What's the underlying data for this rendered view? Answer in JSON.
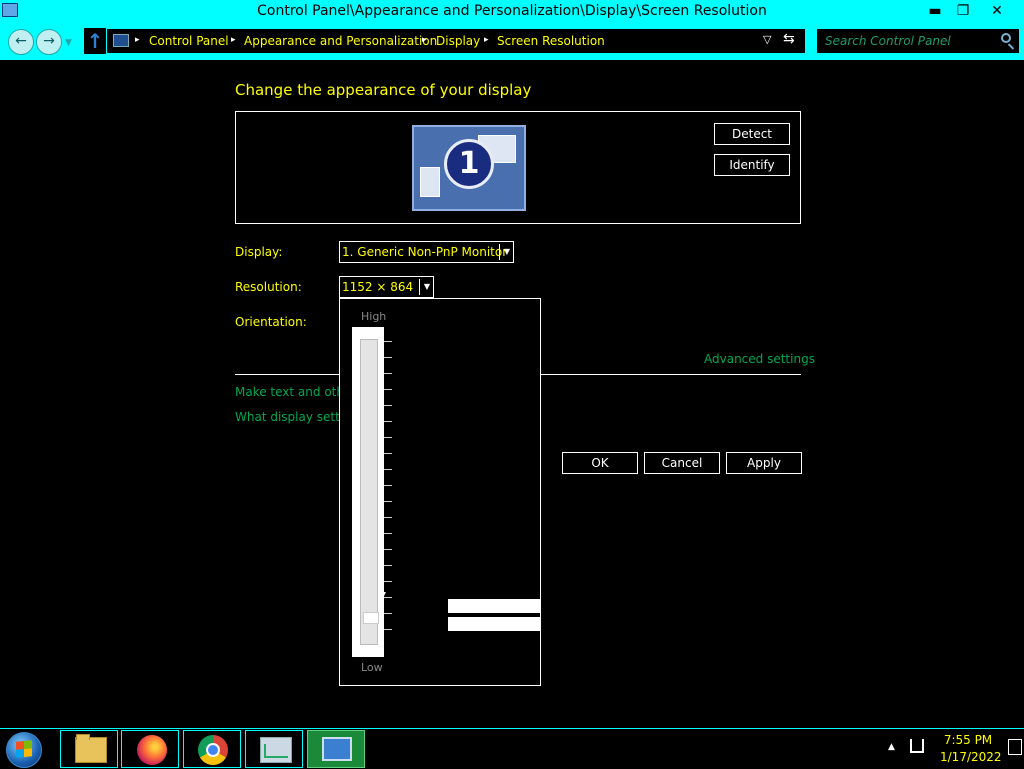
{
  "window": {
    "title": "Control Panel\\Appearance and Personalization\\Display\\Screen Resolution",
    "minimize_glyph": "▬",
    "restore_glyph": "❐",
    "close_glyph": "✕"
  },
  "navigation": {
    "back_glyph": "←",
    "forward_glyph": "→",
    "history_glyph": "▼",
    "up_glyph": "↑",
    "breadcrumbs": [
      "Control Panel",
      "Appearance and Personalization",
      "Display",
      "Screen Resolution"
    ],
    "separator": "▸",
    "dropdown_glyph": "▽",
    "refresh_glyph": "⇆",
    "search_placeholder": "Search Control Panel"
  },
  "content": {
    "heading": "Change the appearance of your display",
    "monitor_number": "1",
    "detect_label": "Detect",
    "identify_label": "Identify",
    "display_label": "Display:",
    "display_value": "1. Generic Non-PnP Monitor",
    "resolution_label": "Resolution:",
    "resolution_value": "1152 × 864",
    "orientation_label": "Orientation:",
    "advanced_settings_link": "Advanced settings",
    "text_size_link": "Make text and other",
    "display_help_link": "What display setting",
    "ok_label": "OK",
    "cancel_label": "Cancel",
    "apply_label": "Apply",
    "combo_arrow": "▼"
  },
  "resolution_slider": {
    "high_label": "High",
    "low_label": "Low"
  },
  "taskbar": {
    "apps": [
      "start",
      "file-explorer",
      "firefox",
      "chrome",
      "performance-monitor",
      "display-settings"
    ],
    "active_app": "display-settings",
    "tray_up_glyph": "▲",
    "time": "7:55 PM",
    "date": "1/17/2022"
  },
  "colors": {
    "chrome_bg": "#00ffff",
    "text_primary": "#ffff00",
    "link": "#00a84f",
    "background": "#000000"
  }
}
